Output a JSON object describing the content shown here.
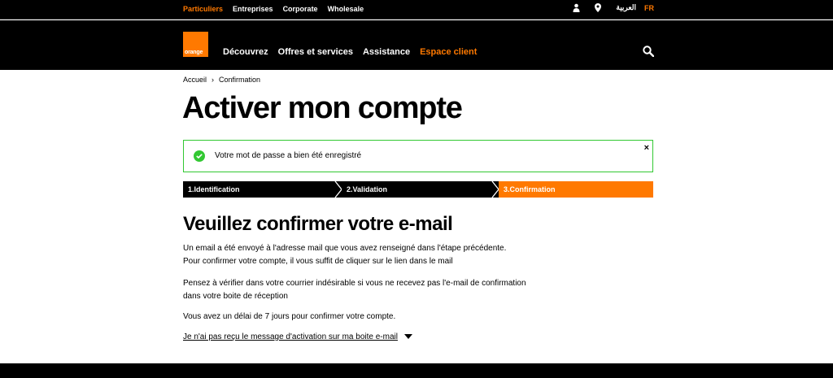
{
  "topbar": {
    "segments": [
      "Particuliers",
      "Entreprises",
      "Corporate",
      "Wholesale"
    ],
    "lang_ar": "العربية",
    "lang_fr": "FR"
  },
  "nav": {
    "logo_text": "orange",
    "links": [
      "Découvrez",
      "Offres et services",
      "Assistance",
      "Espace client"
    ]
  },
  "breadcrumb": {
    "home": "Accueil",
    "sep": "›",
    "current": "Confirmation"
  },
  "page_title": "Activer mon compte",
  "alert": {
    "message": "Votre mot de passe a bien été enregistré",
    "close": "×"
  },
  "steps": [
    "1.Identification",
    "2.Validation",
    "3.Confirmation"
  ],
  "section_title": "Veuillez confirmer votre e-mail",
  "body": {
    "p1_l1": "Un email a été envoyé à l'adresse mail que vous avez renseigné dans l'étape précédente.",
    "p1_l2": "Pour confirmer votre compte, il vous suffit de cliquer sur le lien dans le mail",
    "p2_l1": "Pensez à vérifier dans votre courrier indésirable si vous ne recevez pas l'e-mail de confirmation",
    "p2_l2": "dans votre boite de réception",
    "p3": "Vous avez un délai de 7 jours pour confirmer votre compte."
  },
  "toggle_label": "Je n'ai pas reçu le message d'activation sur ma boite e-mail",
  "colors": {
    "brand": "#ff7900",
    "success": "#32c832",
    "dark": "#000000"
  }
}
